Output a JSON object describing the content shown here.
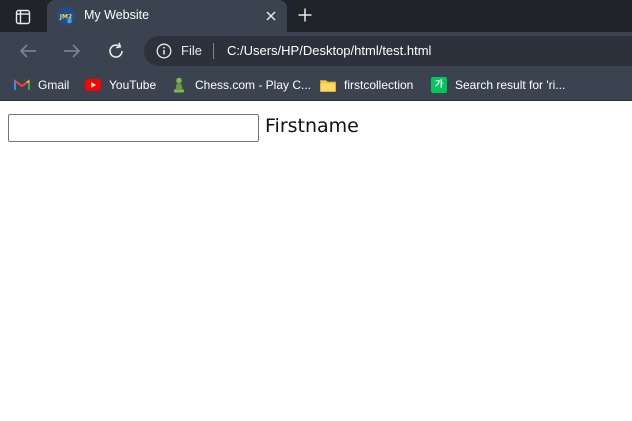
{
  "tab": {
    "title": "My Website",
    "favicon_text": "JM2"
  },
  "address_bar": {
    "scheme_label": "File",
    "url": "C:/Users/HP/Desktop/html/test.html"
  },
  "bookmarks": [
    {
      "label": "Gmail",
      "icon": "gmail-icon"
    },
    {
      "label": "YouTube",
      "icon": "youtube-icon"
    },
    {
      "label": "Chess.com - Play C...",
      "icon": "chess-pawn-icon"
    },
    {
      "label": "firstcollection",
      "icon": "folder-icon"
    },
    {
      "label": "Search result for 'ri...",
      "icon": "naver-dictionary-icon",
      "icon_text": "가"
    }
  ],
  "page": {
    "firstname_input_value": "",
    "firstname_label": "Firstname"
  },
  "colors": {
    "tabstrip_bg": "#202327",
    "toolbar_bg": "#3b4250",
    "omnibox_bg": "#2c313b",
    "page_bg": "#ffffff"
  }
}
